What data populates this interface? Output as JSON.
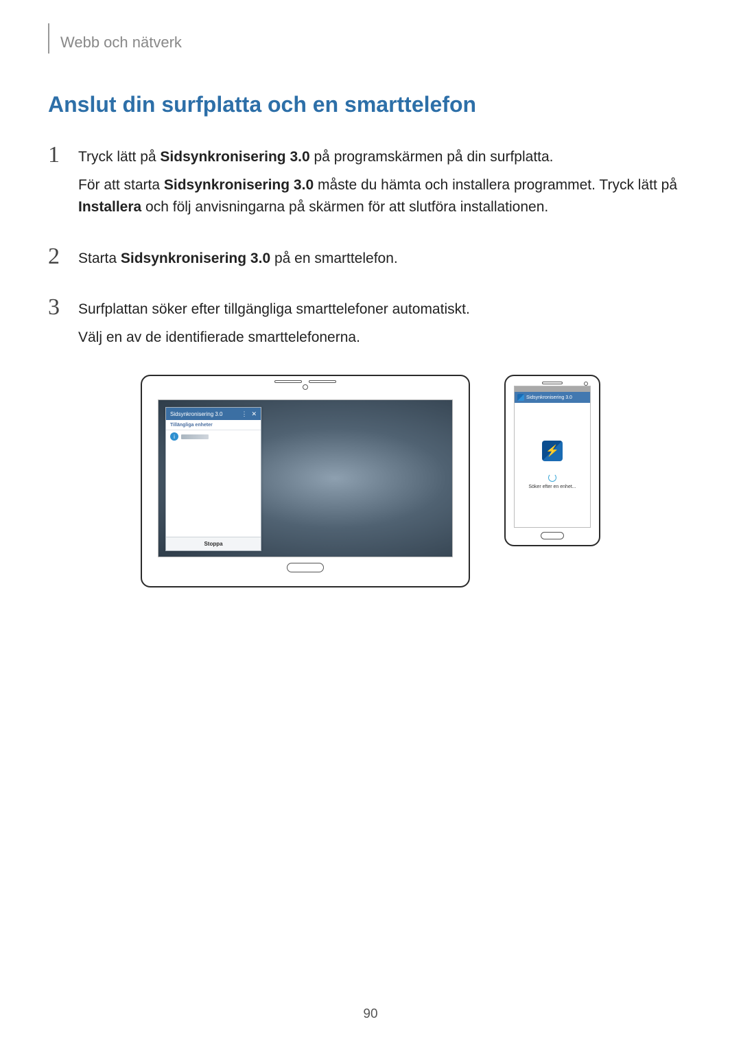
{
  "breadcrumb": "Webb och nätverk",
  "title": "Anslut din surfplatta och en smarttelefon",
  "steps": {
    "1": {
      "num": "1",
      "p1a": "Tryck lätt på ",
      "p1b": "Sidsynkronisering 3.0",
      "p1c": " på programskärmen på din surfplatta.",
      "p2a": "För att starta ",
      "p2b": "Sidsynkronisering 3.0",
      "p2c": " måste du hämta och installera programmet. Tryck lätt på ",
      "p2d": "Installera",
      "p2e": " och följ anvisningarna på skärmen för att slutföra installationen."
    },
    "2": {
      "num": "2",
      "a": "Starta ",
      "b": "Sidsynkronisering 3.0",
      "c": " på en smarttelefon."
    },
    "3": {
      "num": "3",
      "l1": "Surfplattan söker efter tillgängliga smarttelefoner automatiskt.",
      "l2": "Välj en av de identifierade smarttelefonerna."
    }
  },
  "tablet": {
    "panel_title": "Sidsynkronisering 3.0",
    "panel_sub": "Tillängliga enheter",
    "panel_footer": "Stoppa",
    "menu_glyph": "⋮",
    "close_glyph": "✕"
  },
  "phone": {
    "header": "Sidsynkronisering 3.0",
    "searching": "Söker efter en enhet...",
    "icon_glyph": "⚡"
  },
  "page_number": "90"
}
